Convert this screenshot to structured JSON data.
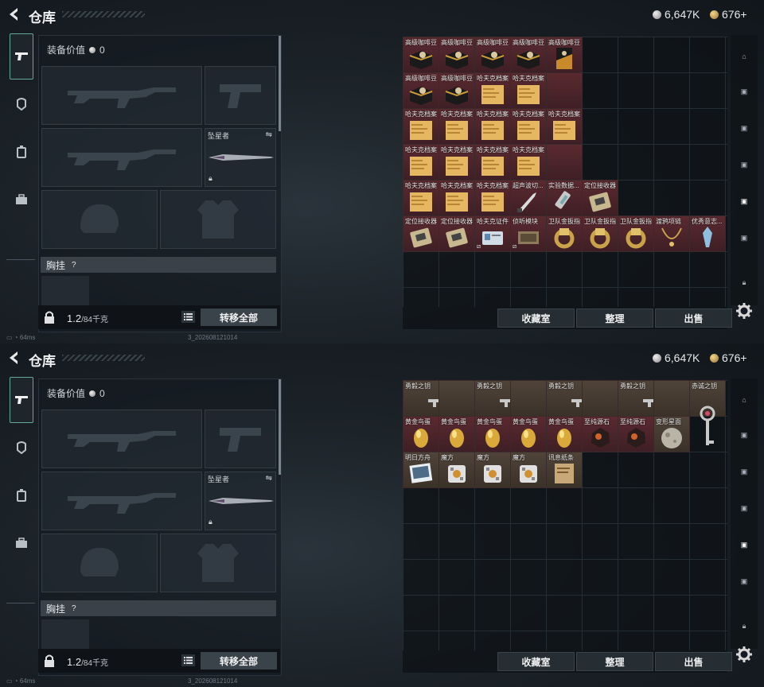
{
  "screens": [
    {
      "title": "仓库",
      "currency": {
        "silver": "6,647K",
        "gold": "676+"
      },
      "equipment": {
        "value_label": "装备价值",
        "value": "0",
        "melee_name": "坠星者",
        "chest_label": "胸挂",
        "chest_help": "?",
        "weight": "1.2",
        "weight_max": "/84千克",
        "transfer_all": "转移全部"
      },
      "stash_rows": [
        [
          {
            "name": "高级咖啡豆",
            "art": "coffee",
            "bg": "r"
          },
          {
            "name": "高级咖啡豆",
            "art": "coffee",
            "bg": "r"
          },
          {
            "name": "高级咖啡豆",
            "art": "coffee",
            "bg": "r"
          },
          {
            "name": "高级咖啡豆",
            "art": "coffee",
            "bg": "r"
          },
          {
            "name": "高级咖啡豆",
            "art": "coffeebag",
            "bg": "r"
          }
        ],
        [
          {
            "name": "高级咖啡豆",
            "art": "coffee",
            "bg": "r"
          },
          {
            "name": "高级咖啡豆",
            "art": "coffee",
            "bg": "r"
          },
          {
            "name": "哈夫克档案",
            "art": "file",
            "bg": "r"
          },
          {
            "name": "哈夫克档案",
            "art": "file",
            "bg": "r"
          },
          {
            "name": "",
            "art": "",
            "bg": "r"
          }
        ],
        [
          {
            "name": "哈夫克档案",
            "art": "file",
            "bg": "r"
          },
          {
            "name": "哈夫克档案",
            "art": "file",
            "bg": "r"
          },
          {
            "name": "哈夫克档案",
            "art": "file",
            "bg": "r"
          },
          {
            "name": "哈夫克档案",
            "art": "file",
            "bg": "r"
          },
          {
            "name": "哈夫克档案",
            "art": "file",
            "bg": "r"
          }
        ],
        [
          {
            "name": "哈夫克档案",
            "art": "file",
            "bg": "r"
          },
          {
            "name": "哈夫克档案",
            "art": "file",
            "bg": "r"
          },
          {
            "name": "哈夫克档案",
            "art": "file",
            "bg": "r"
          },
          {
            "name": "哈夫克档案",
            "art": "file",
            "bg": "r"
          },
          {
            "name": "",
            "art": "",
            "bg": "r"
          }
        ],
        [
          {
            "name": "哈夫克档案",
            "art": "file",
            "bg": "r"
          },
          {
            "name": "哈夫克档案",
            "art": "file",
            "bg": "r"
          },
          {
            "name": "哈夫克档案",
            "art": "file",
            "bg": "r"
          },
          {
            "name": "超声波切...",
            "art": "knife",
            "bg": "r"
          },
          {
            "name": "实验数据...",
            "art": "syringe",
            "bg": "r"
          },
          {
            "name": "定位接收器",
            "art": "device",
            "bg": "r"
          }
        ],
        [
          {
            "name": "定位接收器",
            "art": "device",
            "bg": "r"
          },
          {
            "name": "定位接收器",
            "art": "device",
            "bg": "r"
          },
          {
            "name": "哈夫克证件",
            "art": "card",
            "bg": "r",
            "tag": "⧄"
          },
          {
            "name": "侦听模块",
            "art": "module",
            "bg": "r",
            "tag": "⧄"
          },
          {
            "name": "卫队金扳指",
            "art": "ring",
            "bg": "r"
          },
          {
            "name": "卫队金扳指",
            "art": "ring",
            "bg": "r"
          },
          {
            "name": "卫队金扳指",
            "art": "ring",
            "bg": "r"
          },
          {
            "name": "渡鸦项链",
            "art": "necklace",
            "bg": "r"
          },
          {
            "name": "优秀意志...",
            "art": "crystal",
            "bg": "r"
          }
        ]
      ],
      "buttons": {
        "collection": "收藏室",
        "sort": "整理",
        "sell": "出售"
      },
      "status": {
        "ping": "64ms",
        "build": "3_202608121014"
      }
    },
    {
      "title": "仓库",
      "currency": {
        "silver": "6,647K",
        "gold": "676+"
      },
      "equipment": {
        "value_label": "装备价值",
        "value": "0",
        "melee_name": "坠星者",
        "chest_label": "胸挂",
        "chest_help": "?",
        "weight": "1.2",
        "weight_max": "/84千克",
        "transfer_all": "转移全部"
      },
      "stash_rows": [
        [
          {
            "name": "勇毅之钥",
            "art": "key",
            "bg": "b"
          },
          {
            "name": "",
            "art": "",
            "bg": "b"
          },
          {
            "name": "勇毅之钥",
            "art": "key",
            "bg": "b"
          },
          {
            "name": "",
            "art": "",
            "bg": "b"
          },
          {
            "name": "勇毅之钥",
            "art": "key",
            "bg": "b"
          },
          {
            "name": "",
            "art": "",
            "bg": "b"
          },
          {
            "name": "勇毅之钥",
            "art": "key",
            "bg": "b"
          },
          {
            "name": "",
            "art": "",
            "bg": "b"
          },
          {
            "name": "赤诚之钥",
            "art": "redkey",
            "bg": "b"
          }
        ],
        [
          {
            "name": "黄金鸟蛋",
            "art": "egg",
            "bg": "r"
          },
          {
            "name": "黄金鸟蛋",
            "art": "egg",
            "bg": "r"
          },
          {
            "name": "黄金鸟蛋",
            "art": "egg",
            "bg": "r"
          },
          {
            "name": "黄金鸟蛋",
            "art": "egg",
            "bg": "r"
          },
          {
            "name": "黄金鸟蛋",
            "art": "egg",
            "bg": "r"
          },
          {
            "name": "至纯源石",
            "art": "ore",
            "bg": "r"
          },
          {
            "name": "至纯源石",
            "art": "ore",
            "bg": "r"
          },
          {
            "name": "变形星面",
            "art": "moon",
            "bg": "b"
          }
        ],
        [
          {
            "name": "明日方舟",
            "art": "photo",
            "bg": "b"
          },
          {
            "name": "魔方",
            "art": "cube",
            "bg": "b"
          },
          {
            "name": "魔方",
            "art": "cube",
            "bg": "b"
          },
          {
            "name": "魔方",
            "art": "cube",
            "bg": "b"
          },
          {
            "name": "讯息纸条",
            "art": "paper",
            "bg": "b"
          }
        ]
      ],
      "buttons": {
        "collection": "收藏室",
        "sort": "整理",
        "sell": "出售"
      },
      "status": {
        "ping": "64ms",
        "build": "3_202608121014"
      }
    }
  ],
  "right_nav": [
    "locker-icon",
    "tier-v-icon",
    "tier-iv-icon",
    "tier-iii-icon",
    "tier-iv-b-icon",
    "tier-iv-c-icon",
    "lock-icon"
  ]
}
